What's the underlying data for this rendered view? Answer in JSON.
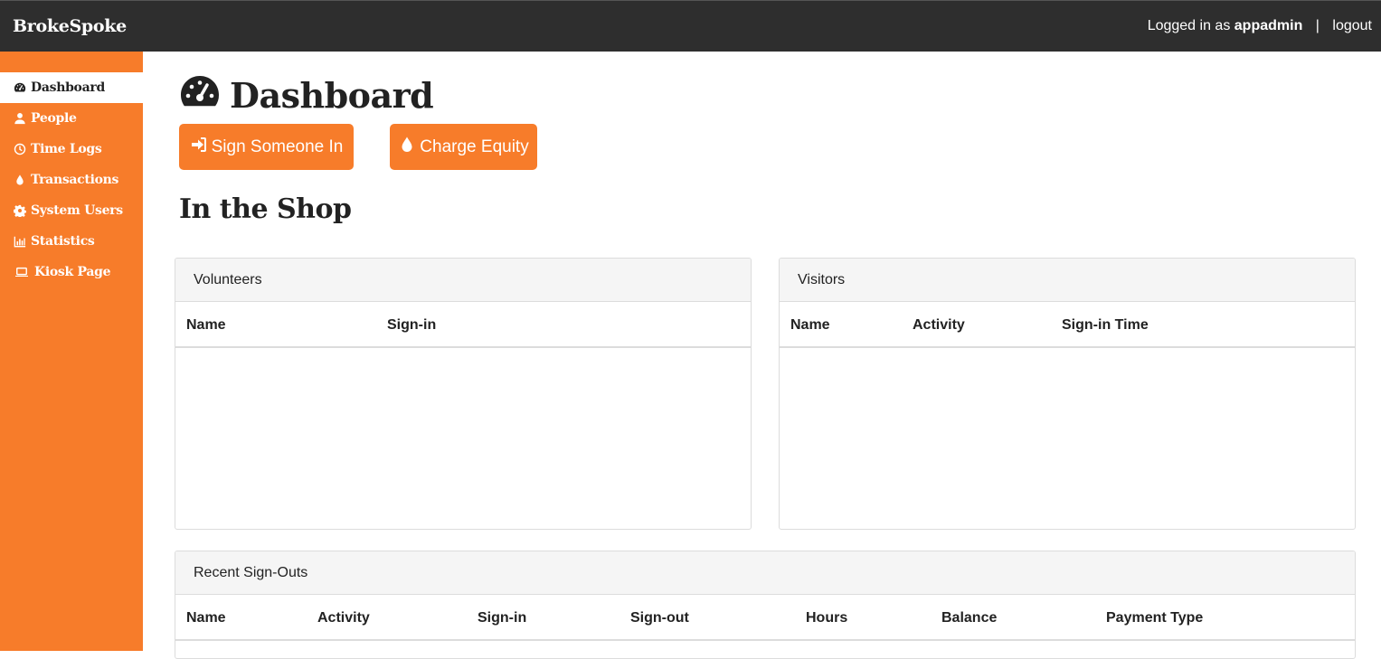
{
  "app": {
    "brand": "BrokeSpoke",
    "logged_in_prefix": "Logged in as",
    "username": "appadmin",
    "separator": "|",
    "logout_label": "logout"
  },
  "sidebar": {
    "items": [
      {
        "label": "Dashboard",
        "icon": "dashboard-icon",
        "active": true
      },
      {
        "label": "People",
        "icon": "user-icon"
      },
      {
        "label": "Time Logs",
        "icon": "clock-icon"
      },
      {
        "label": "Transactions",
        "icon": "drop-icon"
      },
      {
        "label": "System Users",
        "icon": "gear-icon"
      },
      {
        "label": "Statistics",
        "icon": "chart-icon"
      },
      {
        "label": "Kiosk Page",
        "icon": "laptop-icon"
      }
    ]
  },
  "main": {
    "title": "Dashboard",
    "buttons": {
      "sign_in": "Sign Someone In",
      "charge_equity": "Charge Equity"
    },
    "section_title": "In the Shop",
    "volunteers": {
      "title": "Volunteers",
      "columns": [
        "Name",
        "Sign-in"
      ],
      "rows": []
    },
    "visitors": {
      "title": "Visitors",
      "columns": [
        "Name",
        "Activity",
        "Sign-in Time"
      ],
      "rows": []
    },
    "recent_signouts": {
      "title": "Recent Sign-Outs",
      "columns": [
        "Name",
        "Activity",
        "Sign-in",
        "Sign-out",
        "Hours",
        "Balance",
        "Payment Type"
      ],
      "rows": []
    }
  },
  "colors": {
    "accent": "#f77c2a",
    "topbar": "#2e2e2e"
  }
}
